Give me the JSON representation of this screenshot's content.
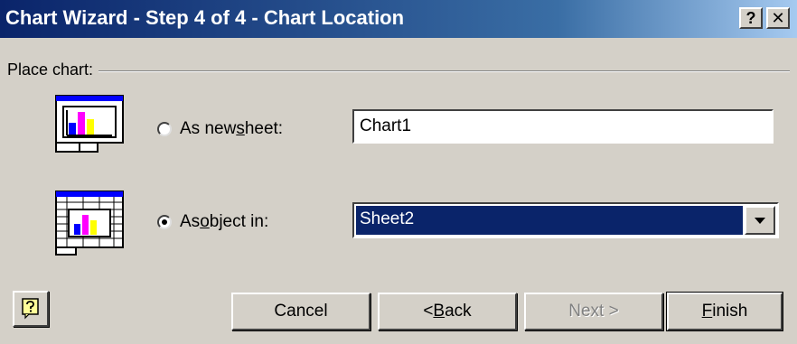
{
  "window": {
    "title": "Chart Wizard - Step 4 of 4 - Chart Location",
    "help_btn": "?",
    "close_btn": "✕"
  },
  "group": {
    "label": "Place chart:"
  },
  "options": {
    "new_sheet": {
      "label_pre": "As new ",
      "label_u": "s",
      "label_post": "heet:",
      "selected": false,
      "value": "Chart1"
    },
    "object_in": {
      "label_pre": "As ",
      "label_u": "o",
      "label_post": "bject in:",
      "selected": true,
      "value": "Sheet2"
    }
  },
  "icons": {
    "new_sheet_icon": "chart-sheet-icon",
    "object_icon": "embedded-chart-icon",
    "office_assistant_icon": "office-assistant-icon",
    "dropdown_icon": "chevron-down-icon"
  },
  "buttons": {
    "cancel": "Cancel",
    "back_pre": "< ",
    "back_u": "B",
    "back_post": "ack",
    "next": "Next >",
    "finish_u": "F",
    "finish_post": "inish"
  },
  "colors": {
    "titlebar_start": "#0a246a",
    "titlebar_end": "#a6caf0",
    "dialog_bg": "#d4d0c8",
    "selection": "#0a246a"
  }
}
